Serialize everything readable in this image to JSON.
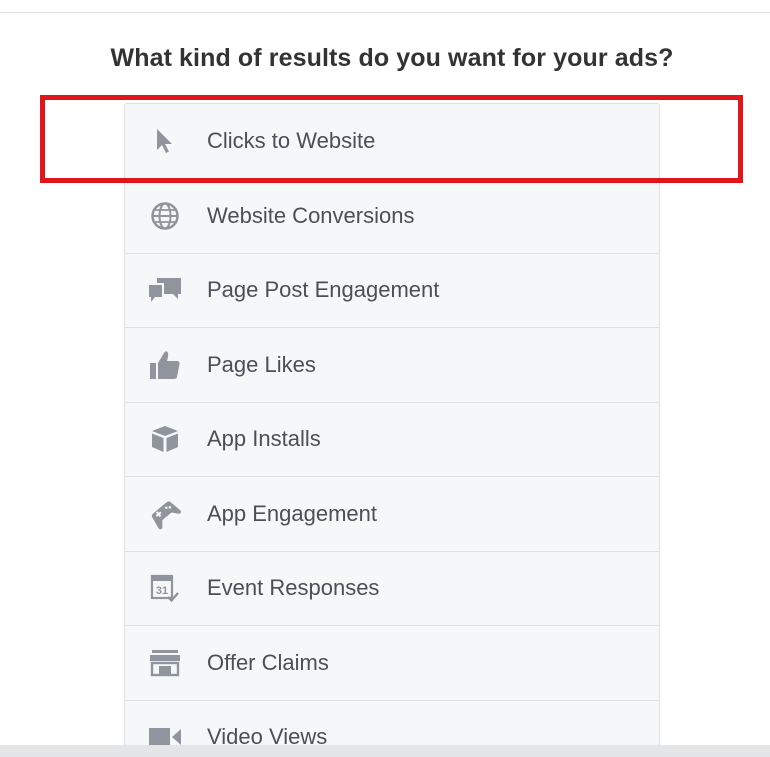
{
  "heading": "What kind of results do you want for your ads?",
  "objectives": [
    {
      "label": "Clicks to Website",
      "icon": "cursor-icon"
    },
    {
      "label": "Website Conversions",
      "icon": "globe-icon"
    },
    {
      "label": "Page Post Engagement",
      "icon": "speech-bubbles-icon"
    },
    {
      "label": "Page Likes",
      "icon": "thumbs-up-icon"
    },
    {
      "label": "App Installs",
      "icon": "box-icon"
    },
    {
      "label": "App Engagement",
      "icon": "gamepad-icon"
    },
    {
      "label": "Event Responses",
      "icon": "calendar-icon"
    },
    {
      "label": "Offer Claims",
      "icon": "storefront-icon"
    },
    {
      "label": "Video Views",
      "icon": "video-camera-icon"
    }
  ],
  "colors": {
    "highlight": "#e0161c",
    "icon": "#90949c",
    "text": "#4b4f56",
    "heading": "#333333",
    "list_background": "#f6f7f9"
  }
}
